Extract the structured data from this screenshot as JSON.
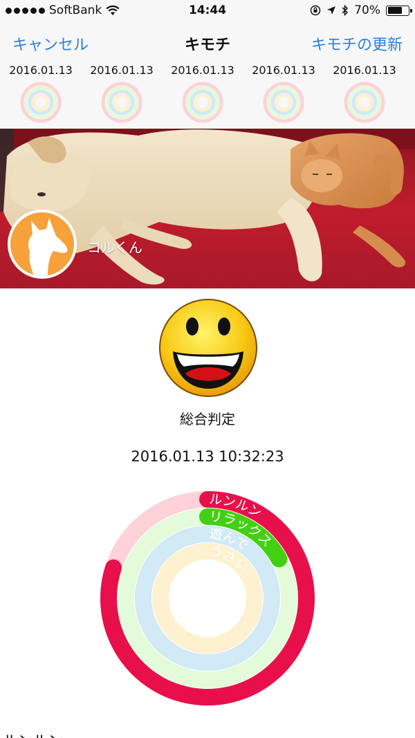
{
  "status_bar": {
    "carrier": "SoftBank",
    "time": "14:44",
    "battery": "70%",
    "battery_level": 0.7,
    "icons": [
      "signal-dots",
      "wifi-icon",
      "rotation-lock-icon",
      "location-arrow-icon",
      "bluetooth-icon",
      "battery-icon"
    ]
  },
  "nav": {
    "cancel": "キャンセル",
    "title": "キモチ",
    "update": "キモチの更新"
  },
  "history": [
    {
      "date": "2016.01.13"
    },
    {
      "date": "2016.01.13"
    },
    {
      "date": "2016.01.13"
    },
    {
      "date": "2016.01.13"
    },
    {
      "date": "2016.01.13"
    }
  ],
  "pet": {
    "name": "コルくん",
    "avatar_color": "#f6a13a"
  },
  "result": {
    "overall_label": "総合判定",
    "timestamp": "2016.01.13 10:32:23",
    "face_icon": "laughing-face-icon"
  },
  "rings": [
    {
      "label": "ルンルン",
      "color": "#e8104a",
      "track_color": "#ffd1d9",
      "value": 0.8
    },
    {
      "label": "リラックス",
      "color": "#44d012",
      "track_color": "#e4fbd9",
      "value": 0.17
    },
    {
      "label": "遊んで",
      "color": "#bfe2f4",
      "track_color": "#d2e9f6",
      "value": 0
    },
    {
      "label": "うさい",
      "color": "#fdeec6",
      "track_color": "#fdf1cf",
      "value": 0
    }
  ],
  "bottom_section_label": "ルンルン"
}
